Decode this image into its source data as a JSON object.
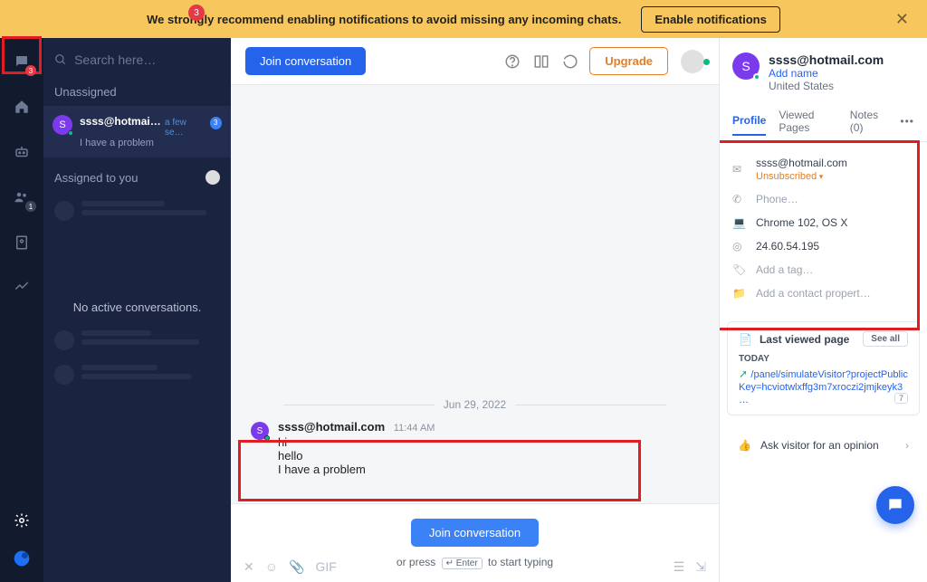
{
  "notification": {
    "badge": "3",
    "message": "We strongly recommend enabling notifications to avoid missing any incoming chats.",
    "button": "Enable notifications"
  },
  "rail": {
    "chat_badge": "3",
    "team_badge": "1"
  },
  "sidebar": {
    "search_placeholder": "Search here…",
    "unassigned_title": "Unassigned",
    "conversation": {
      "name": "ssss@hotmail….",
      "time": "a few se…",
      "badge": "3",
      "preview": "I have a problem"
    },
    "assigned_title": "Assigned to you",
    "no_active": "No active conversations."
  },
  "topbar": {
    "join": "Join conversation",
    "upgrade": "Upgrade"
  },
  "chat": {
    "date": "Jun 29, 2022",
    "message": {
      "author": "ssss@hotmail.com",
      "time": "11:44 AM",
      "lines": [
        "hi",
        "hello",
        "I have a problem"
      ]
    }
  },
  "input": {
    "join": "Join conversation",
    "press_pre": "or press",
    "press_key": "↵ Enter",
    "press_post": "to start typing"
  },
  "contact": {
    "initial": "S",
    "name": "ssss@hotmail.com",
    "add_name": "Add name",
    "location": "United States",
    "tabs": {
      "profile": "Profile",
      "viewed": "Viewed Pages",
      "notes": "Notes (0)"
    },
    "email": "ssss@hotmail.com",
    "unsub": "Unsubscribed",
    "phone": "Phone…",
    "browser": "Chrome 102, OS X",
    "ip": "24.60.54.195",
    "add_tag": "Add a tag…",
    "add_prop": "Add a contact propert…",
    "last_viewed_title": "Last viewed page",
    "see_all": "See all",
    "today": "TODAY",
    "viewed_url": "/panel/simulateVisitor?projectPublicKey=hcviotwlxffg3m7xroczi2jmjkeyk3 …",
    "viewed_count": "7",
    "ask": "Ask visitor for an opinion"
  }
}
